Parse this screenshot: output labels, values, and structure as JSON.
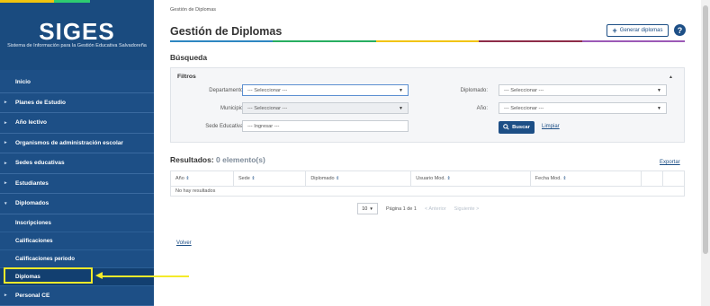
{
  "brand": {
    "title": "SIGES",
    "subtitle": "Sistema de Información para la Gestión Educativa Salvadoreña"
  },
  "sidebar": {
    "items": [
      {
        "label": "Inicio",
        "caret": ""
      },
      {
        "label": "Planes de Estudio",
        "caret": "▸"
      },
      {
        "label": "Año lectivo",
        "caret": "▸"
      },
      {
        "label": "Organismos de administración escolar",
        "caret": "▸"
      },
      {
        "label": "Sedes educativas",
        "caret": "▸"
      },
      {
        "label": "Estudiantes",
        "caret": "▸"
      },
      {
        "label": "Diplomados",
        "caret": "▾"
      }
    ],
    "subitems": [
      {
        "label": "Inscripciones"
      },
      {
        "label": "Calificaciones"
      },
      {
        "label": "Calificaciones periodo"
      },
      {
        "label": "Diplomas"
      }
    ],
    "last_item": {
      "label": "Personal CE",
      "caret": "▸"
    }
  },
  "header": {
    "breadcrumb": "Gestión de Diplomas",
    "title": "Gestión de Diplomas",
    "generate_label": "Generar diplomas",
    "help_symbol": "?"
  },
  "search": {
    "section_title": "Búsqueda",
    "filters_title": "Filtros",
    "departamento_label": "Departamento:",
    "departamento_value": "--- Seleccionar ---",
    "municipio_label": "Municipio:",
    "municipio_value": "--- Seleccionar ---",
    "sede_label": "Sede Educativa:",
    "sede_placeholder": "--- Ingresar ---",
    "diplomado_label": "Diplomado:",
    "diplomado_value": "--- Seleccionar ---",
    "anio_label": "Año:",
    "anio_value": "--- Seleccionar ---",
    "search_button": "Buscar",
    "clear_link": "Limpiar"
  },
  "results": {
    "title": "Resultados:",
    "count": "0 elemento(s)",
    "export_link": "Exportar",
    "columns": [
      "Año",
      "Sede",
      "Diplomado",
      "Usuario Mod.",
      "Fecha Mod."
    ],
    "empty_message": "No hay resultados"
  },
  "pager": {
    "page_size": "10",
    "page_info": "Página 1 de 1",
    "prev": "< Anterior",
    "next": "Siguiente >"
  },
  "footer": {
    "back_link": "Volver"
  },
  "colors": {
    "sidebar_bg": "#1d4f86",
    "accent": "#1d4f86",
    "highlight": "#f4ea2a",
    "rule": [
      "#2e86c1",
      "#27ae60",
      "#f1c40f",
      "#8e2c48",
      "#9b59b6"
    ]
  },
  "icons": {
    "generate": "plus-icon",
    "help": "help-icon",
    "search": "search-icon",
    "dropdown": "chevron-down-icon"
  }
}
